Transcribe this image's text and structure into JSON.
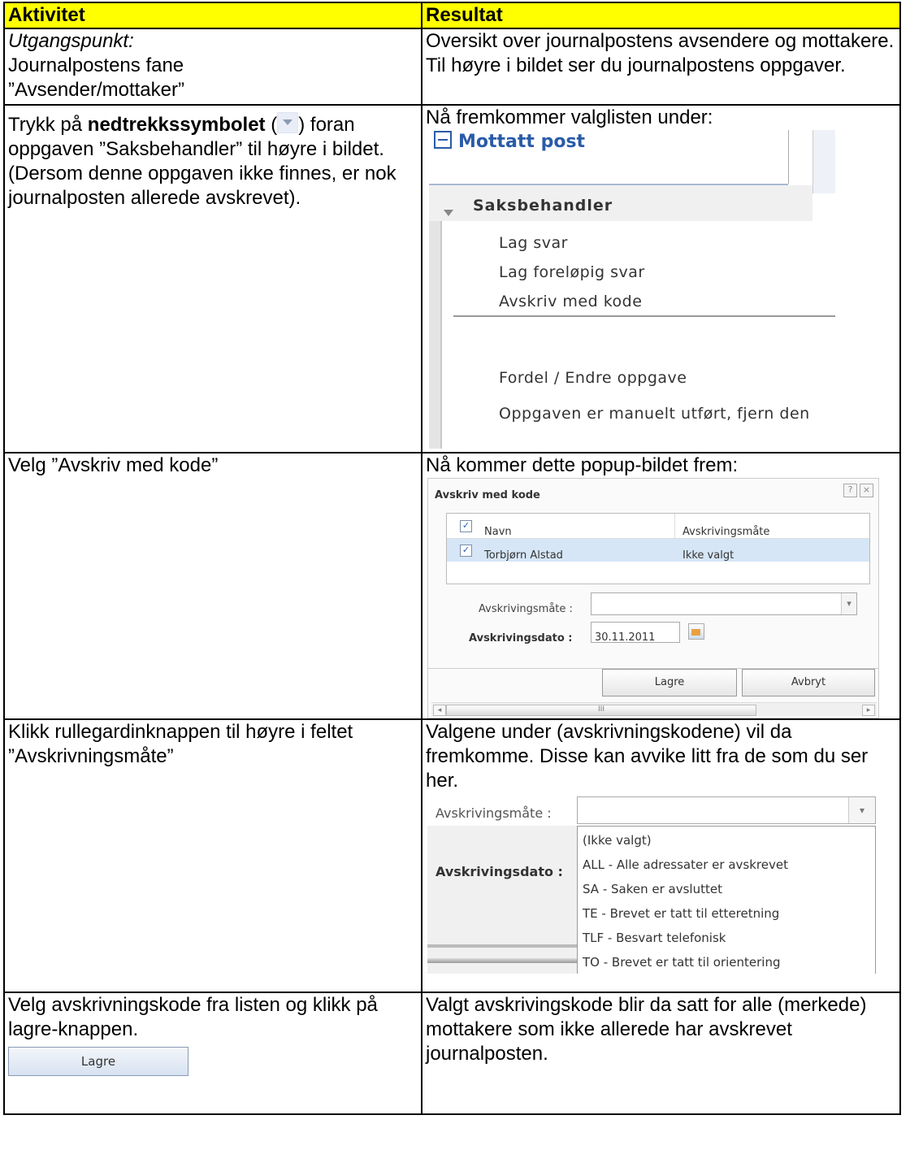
{
  "header": {
    "col1": "Aktivitet",
    "col2": "Resultat"
  },
  "rows": [
    {
      "left_intro_italic": "Utgangspunkt:",
      "left_line1": "Journalpostens fane",
      "left_line2": "”Avsender/mottaker”",
      "right": "Oversikt over journalpostens avsendere og mottakere. Til høyre i bildet ser du journalpostens oppgaver."
    },
    {
      "left_pre": "Trykk på ",
      "left_bold": "nedtrekkssymbolet",
      "left_open_paren": " (",
      "left_close_paren": ")",
      "left_after": "foran oppgaven ”Saksbehandler” til høyre i bildet.",
      "left_note": "(Dersom denne oppgaven ikke finnes, er nok journalposten allerede avskrevet).",
      "right_intro": "Nå fremkommer valglisten under:",
      "menu": {
        "group": "Mottatt post",
        "task": "Saksbehandler",
        "items": [
          "Lag svar",
          "Lag foreløpig svar",
          "Avskriv med kode",
          "Fordel / Endre oppgave",
          "Oppgaven er manuelt utført, fjern den"
        ]
      }
    },
    {
      "left": "Velg ”Avskriv med kode”",
      "right_intro": "Nå kommer dette popup-bildet frem:",
      "dialog": {
        "title": "Avskriv med kode",
        "help": "?",
        "close": "×",
        "col_name": "Navn",
        "col_method": "Avskrivingsmåte",
        "row_name": "Torbjørn Alstad",
        "row_method": "Ikke valgt",
        "method_label": "Avskrivingsmåte :",
        "date_label": "Avskrivingsdato :",
        "date_value": "30.11.2011",
        "save": "Lagre",
        "cancel": "Avbryt",
        "scroll_thumb": "III"
      }
    },
    {
      "left": "Klikk rullegardinknappen til høyre i feltet ”Avskrivningsmåte”",
      "right_intro": "Valgene under (avskrivningskodene) vil da fremkomme. Disse kan avvike litt fra de som du ser her.",
      "codes": {
        "method_label": "Avskrivingsmåte :",
        "date_label": "Avskrivingsdato :",
        "options": [
          "(Ikke valgt)",
          "ALL - Alle adressater er avskrevet",
          "SA - Saken er avsluttet",
          "TE - Brevet er tatt til etteretning",
          "TLF - Besvart telefonisk",
          "TO - Brevet er tatt til orientering"
        ]
      }
    },
    {
      "left": "Velg avskrivningskode fra listen og klikk på lagre-knappen.",
      "button": "Lagre",
      "right": "Valgt avskrivingskode blir da satt for alle (merkede) mottakere som ikke allerede har avskrevet journalposten."
    }
  ]
}
